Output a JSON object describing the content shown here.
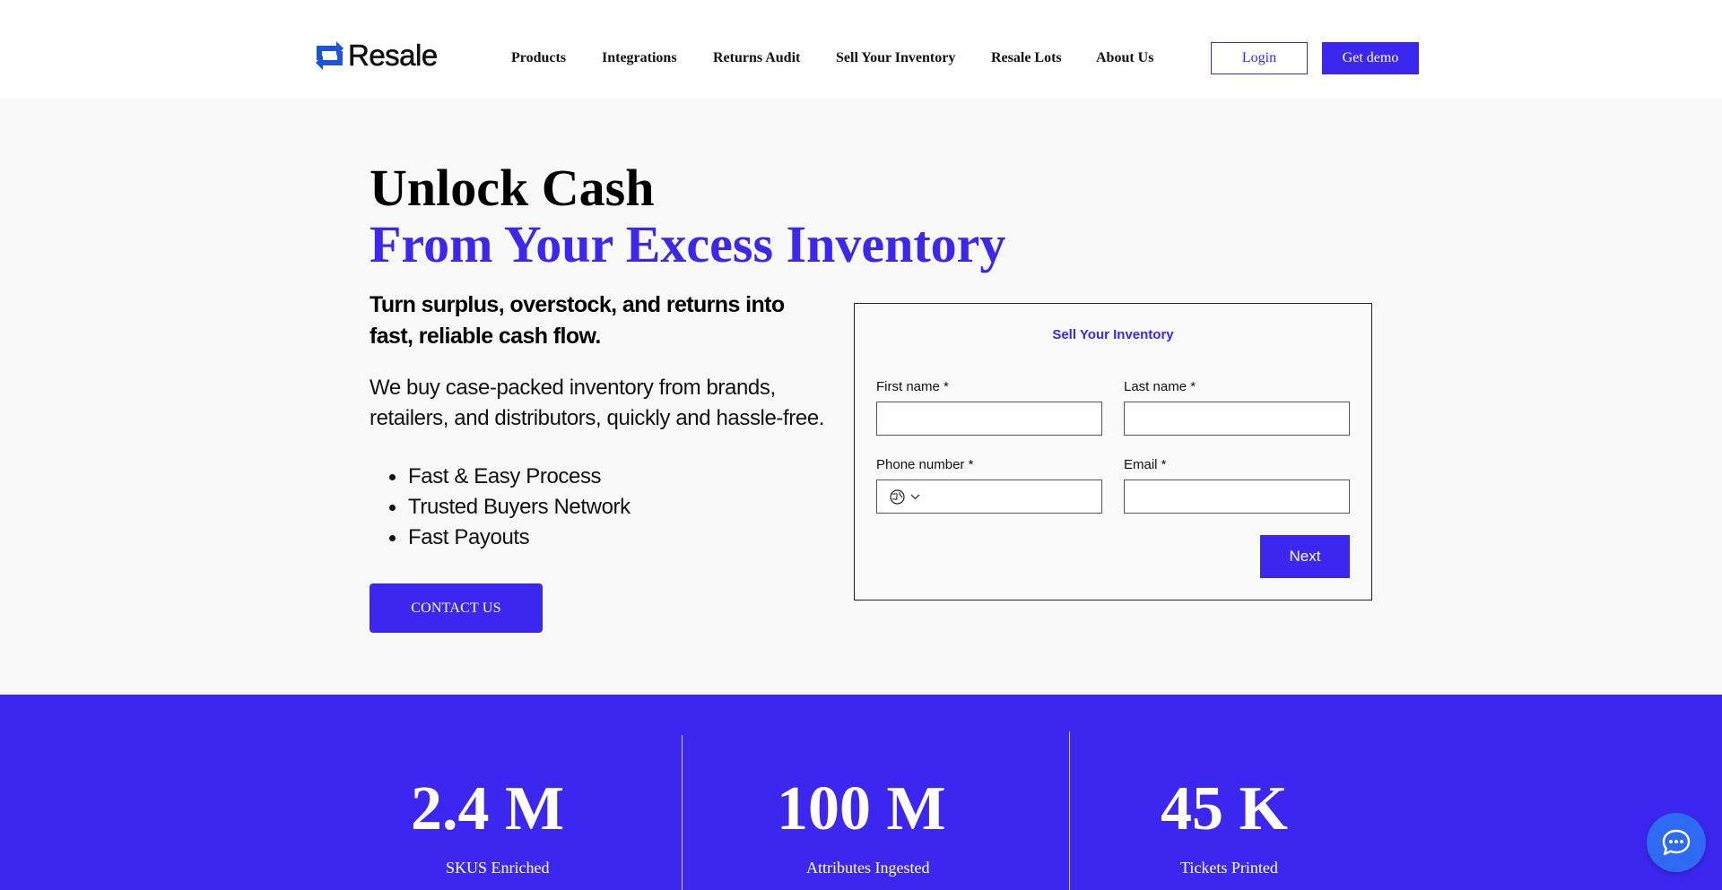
{
  "header": {
    "logo_text": "Resale",
    "nav": [
      "Products",
      "Integrations",
      "Returns Audit",
      "Sell Your Inventory",
      "Resale Lots",
      "About Us"
    ],
    "login_label": "Login",
    "demo_label": "Get demo"
  },
  "hero": {
    "title_line1": "Unlock Cash",
    "title_line2": "From Your Excess Inventory",
    "subtitle": "Turn surplus, overstock, and returns into fast, reliable cash flow.",
    "description": "We buy case-packed inventory from brands, retailers, and distributors, quickly and hassle-free.",
    "bullets": [
      "Fast & Easy Process",
      "Trusted Buyers Network",
      "Fast Payouts"
    ],
    "contact_label": "CONTACT US"
  },
  "form": {
    "title": "Sell Your Inventory",
    "first_name_label": "First name *",
    "last_name_label": "Last name *",
    "phone_label": "Phone number *",
    "email_label": "Email *",
    "first_name_value": "",
    "last_name_value": "",
    "phone_value": "",
    "email_value": "",
    "next_label": "Next"
  },
  "stats": [
    {
      "value": "2.4 M",
      "label": "SKUS Enriched"
    },
    {
      "value": "100 M",
      "label": "Attributes Ingested"
    },
    {
      "value": "45 K",
      "label": "Tickets Printed"
    }
  ],
  "colors": {
    "brand": "#3b27f0",
    "chat": "#2e6bf5"
  },
  "icons": {
    "logo": "resale-logo-icon",
    "globe": "globe-icon",
    "chevron": "chevron-down-icon",
    "chat": "chat-bubble-icon"
  }
}
